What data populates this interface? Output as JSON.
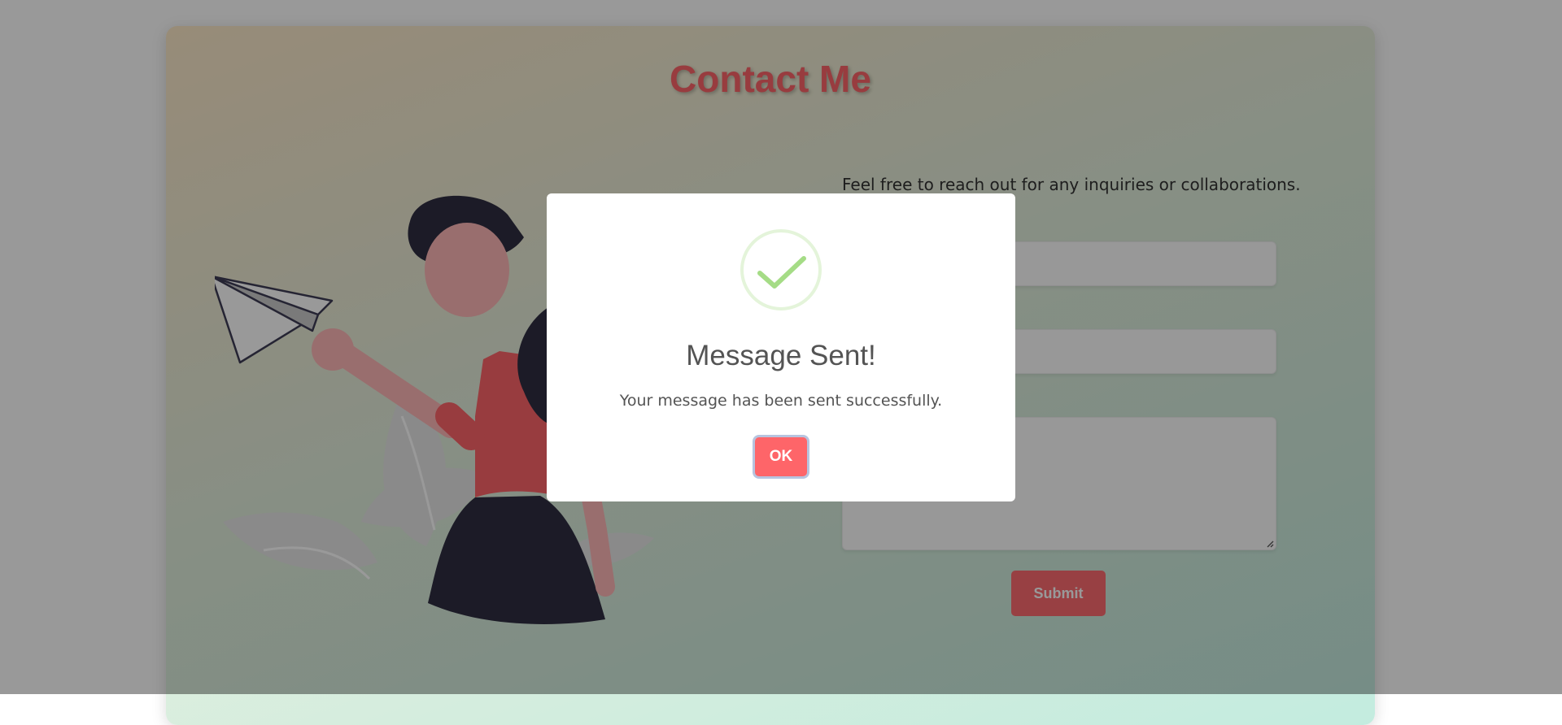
{
  "page": {
    "title": "Contact Me"
  },
  "contact": {
    "intro": "Feel free to reach out for any inquiries or collaborations.",
    "submit_label": "Submit"
  },
  "modal": {
    "icon": "success-check-icon",
    "title": "Message Sent!",
    "text": "Your message has been sent successfully.",
    "ok_label": "OK"
  },
  "colors": {
    "accent": "#fe6569",
    "success": "#a5dc86",
    "overlay": "rgba(0,0,0,0.4)"
  }
}
